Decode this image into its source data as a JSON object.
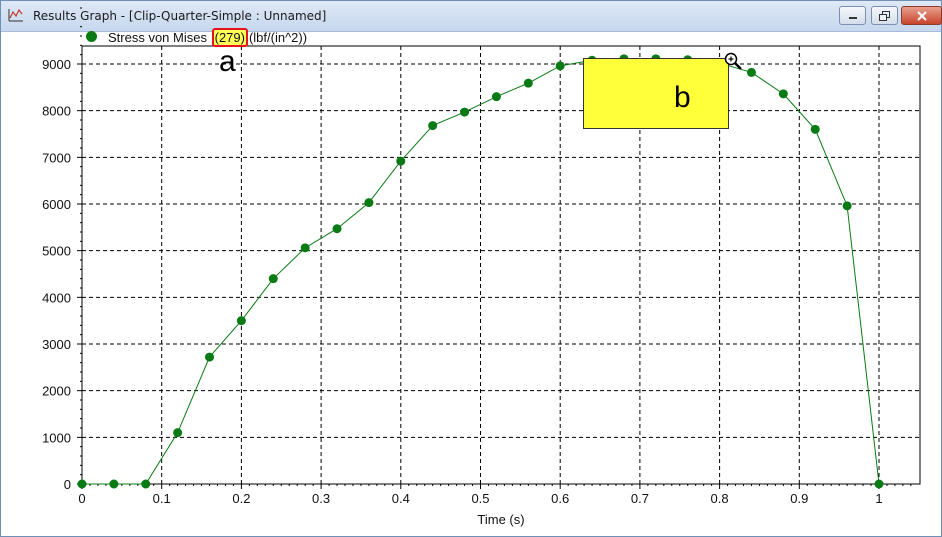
{
  "window": {
    "title": "Results Graph - [Clip-Quarter-Simple : Unnamed]",
    "buttons": [
      "minimize",
      "restore",
      "close"
    ]
  },
  "legend": {
    "series_name": "Stress von Mises",
    "count": "(279)",
    "units": "(lbf/(in^2))"
  },
  "annotations": {
    "label_a": "a",
    "label_b": "b"
  },
  "colors": {
    "series": "#0a7a14",
    "highlight_fill": "#ffff3a",
    "count_border": "#e8121d",
    "count_fill": "#ffff58"
  },
  "chart_data": {
    "type": "line",
    "xlabel": "Time (s)",
    "ylabel": "",
    "xlim": [
      0,
      1.05
    ],
    "ylim": [
      0,
      9500
    ],
    "grid": true,
    "x_ticks": [
      "0",
      "0.1",
      "0.2",
      "0.3",
      "0.4",
      "0.5",
      "0.6",
      "0.7",
      "0.8",
      "0.9",
      "1"
    ],
    "y_ticks": [
      "0",
      "1000",
      "2000",
      "3000",
      "4000",
      "5000",
      "6000",
      "7000",
      "8000",
      "9000"
    ],
    "series": [
      {
        "name": "Stress von Mises",
        "x": [
          0,
          0.04,
          0.08,
          0.12,
          0.16,
          0.2,
          0.24,
          0.28,
          0.32,
          0.36,
          0.4,
          0.44,
          0.48,
          0.52,
          0.56,
          0.6,
          0.64,
          0.68,
          0.72,
          0.76,
          0.8,
          0.84,
          0.88,
          0.92,
          0.96,
          1.0
        ],
        "y": [
          0,
          0,
          0,
          1100,
          2720,
          3500,
          4400,
          5060,
          5470,
          6030,
          6920,
          7680,
          7970,
          8300,
          8590,
          8960,
          9080,
          9110,
          9110,
          9090,
          9020,
          8820,
          8360,
          7600,
          5960,
          0
        ]
      }
    ]
  }
}
